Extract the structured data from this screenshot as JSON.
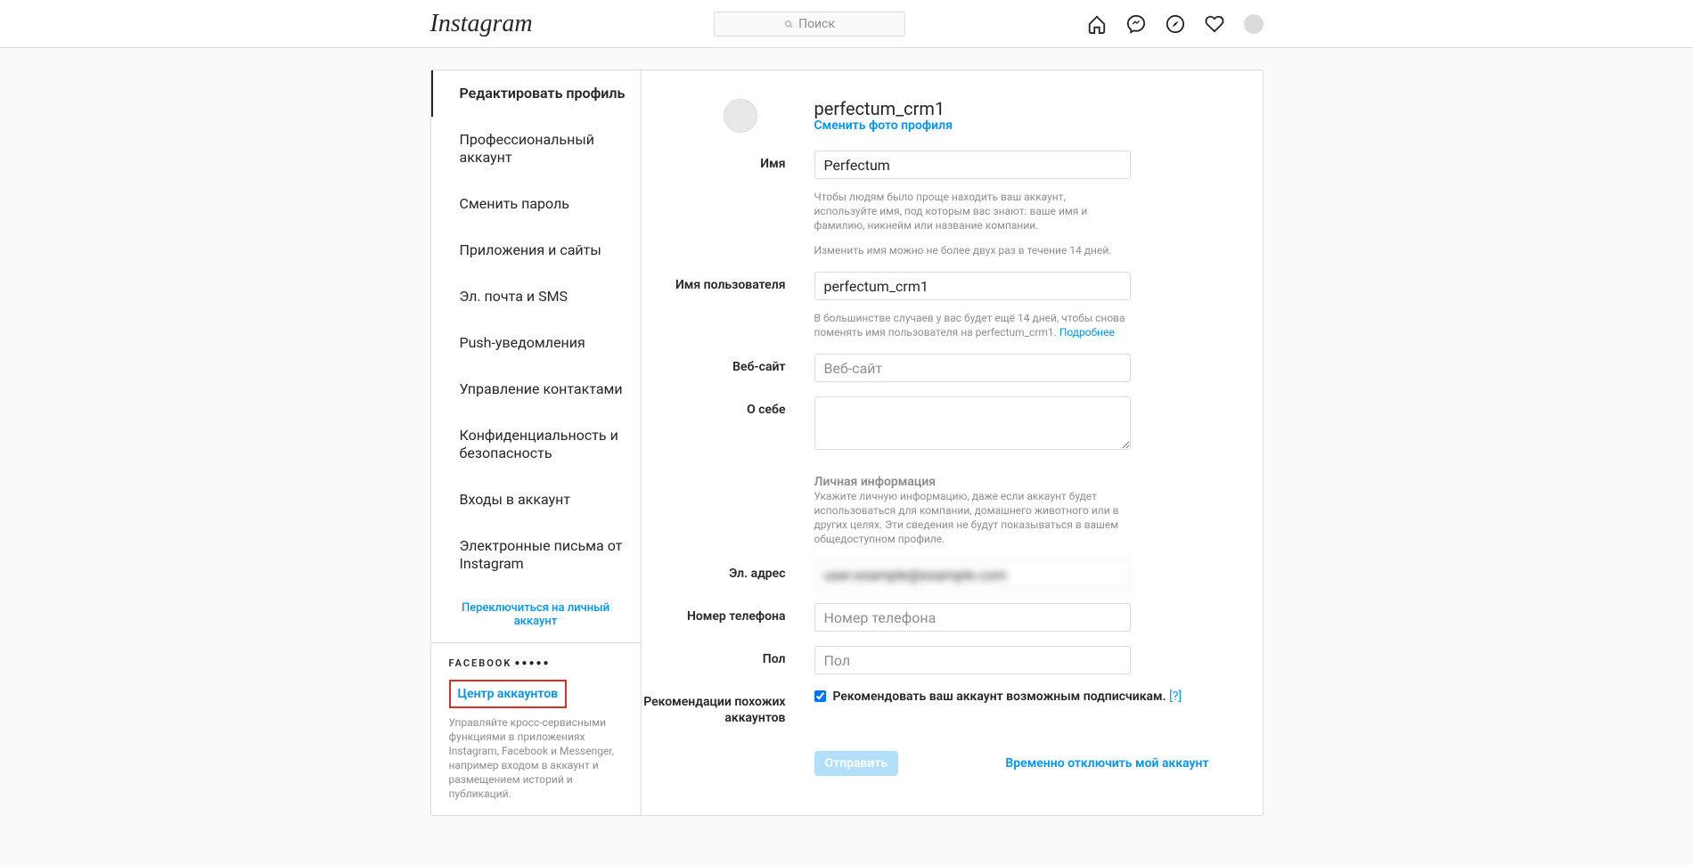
{
  "brand": "Instagram",
  "search": {
    "placeholder": "Поиск"
  },
  "sidebar": {
    "items": [
      "Редактировать профиль",
      "Профессиональный аккаунт",
      "Сменить пароль",
      "Приложения и сайты",
      "Эл. почта и SMS",
      "Push-уведомления",
      "Управление контактами",
      "Конфиденциальность и безопасность",
      "Входы в аккаунт",
      "Электронные письма от Instagram"
    ],
    "switch_link": "Переключиться на личный аккаунт",
    "fb_label": "FACEBOOK",
    "accounts_center": "Центр аккаунтов",
    "accounts_desc": "Управляйте кросс-сервисными функциями в приложениях Instagram, Facebook и Messenger, например входом в аккаунт и размещением историй и публикаций."
  },
  "profile": {
    "username": "perfectum_crm1",
    "change_photo": "Сменить фото профиля"
  },
  "form": {
    "name_label": "Имя",
    "name_value": "Perfectum",
    "name_help1": "Чтобы людям было проще находить ваш аккаунт, используйте имя, под которым вас знают: ваше имя и фамилию, никнейм или название компании.",
    "name_help2": "Изменить имя можно не более двух раз в течение 14 дней.",
    "username_label": "Имя пользователя",
    "username_value": "perfectum_crm1",
    "username_help": "В большинстве случаев у вас будет ещё 14 дней, чтобы снова поменять имя пользователя на perfectum_crm1. ",
    "username_help_link": "Подробнее",
    "website_label": "Веб-сайт",
    "website_placeholder": "Веб-сайт",
    "bio_label": "О себе",
    "personal_head": "Личная информация",
    "personal_desc": "Укажите личную информацию, даже если аккаунт будет использоваться для компании, домашнего животного или в других целях. Эти сведения не будут показываться в вашем общедоступном профиле.",
    "email_label": "Эл. адрес",
    "email_value": "user.example@example.com",
    "phone_label": "Номер телефона",
    "phone_placeholder": "Номер телефона",
    "gender_label": "Пол",
    "gender_placeholder": "Пол",
    "similar_label": "Рекомендации похожих аккаунтов",
    "similar_checkbox": "Рекомендовать ваш аккаунт возможным подписчикам.",
    "similar_help": "[?]",
    "submit": "Отправить",
    "disable": "Временно отключить мой аккаунт"
  }
}
